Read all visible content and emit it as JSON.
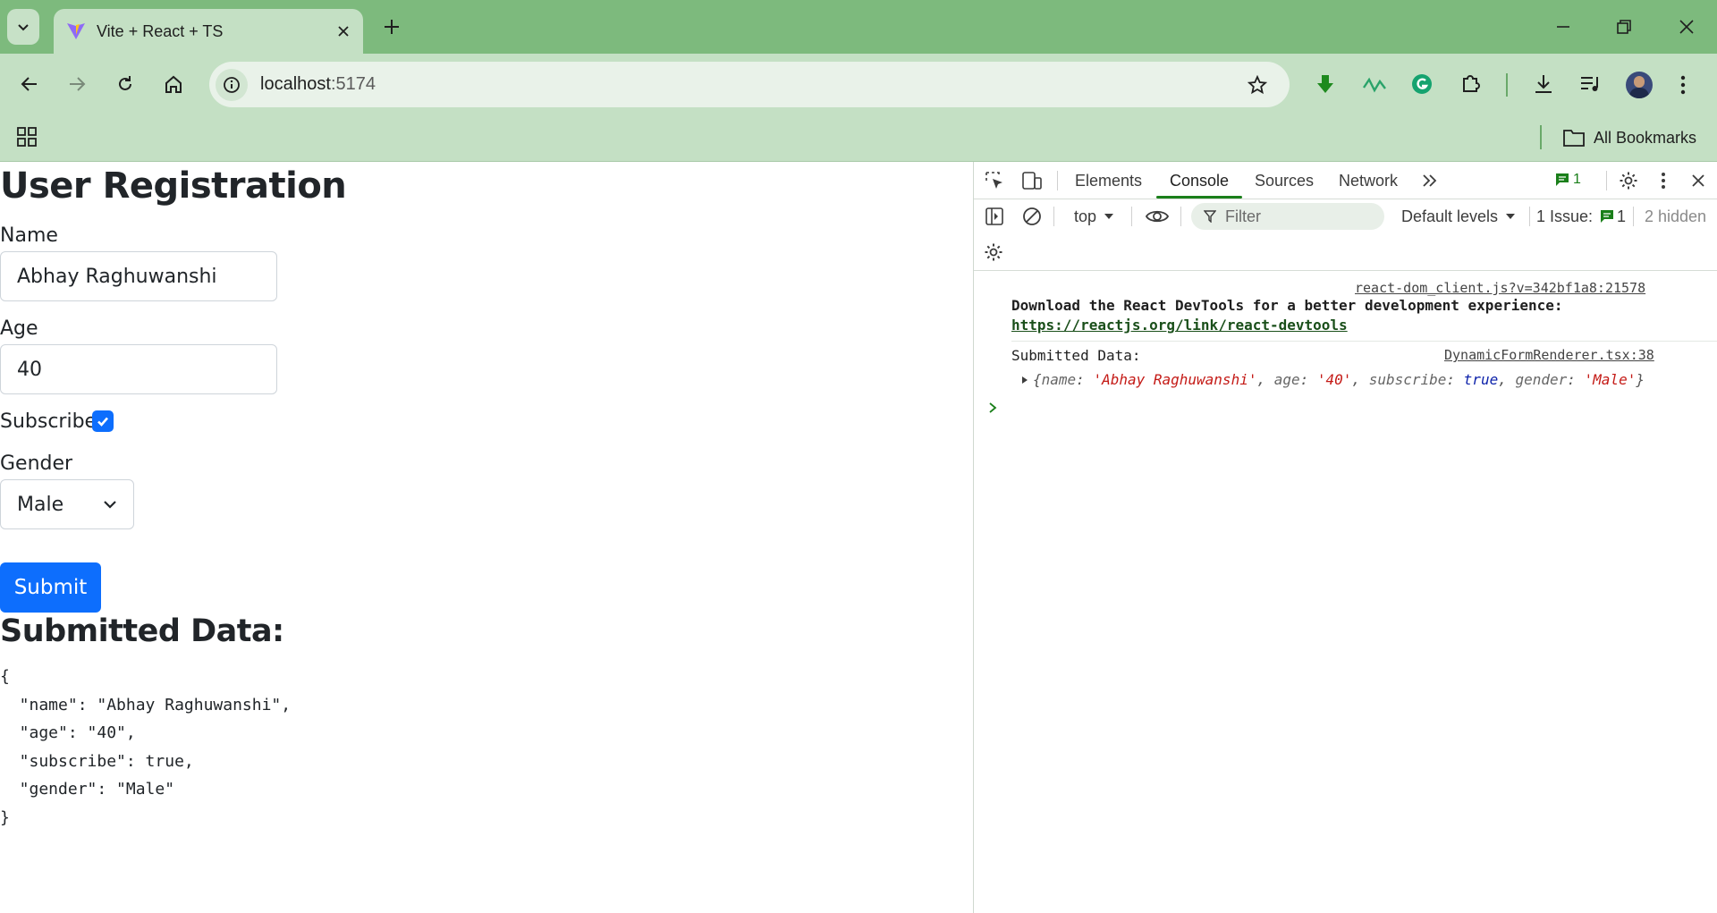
{
  "browser": {
    "tab_title": "Vite + React + TS",
    "url_host": "localhost",
    "url_port": ":5174",
    "bookmarks_label": "All Bookmarks"
  },
  "page": {
    "title": "User Registration",
    "fields": {
      "name_label": "Name",
      "name_value": "Abhay Raghuwanshi",
      "age_label": "Age",
      "age_value": "40",
      "subscribe_label": "Subscribe",
      "subscribe_checked": true,
      "gender_label": "Gender",
      "gender_value": "Male"
    },
    "submit_label": "Submit",
    "submitted_heading": "Submitted Data:",
    "json_lines": [
      "{",
      "  \"name\": \"Abhay Raghuwanshi\",",
      "  \"age\": \"40\",",
      "  \"subscribe\": true,",
      "  \"gender\": \"Male\"",
      "}"
    ]
  },
  "devtools": {
    "tabs": [
      "Elements",
      "Console",
      "Sources",
      "Network"
    ],
    "active_tab": "Console",
    "message_count": "1",
    "context": "top",
    "filter_placeholder": "Filter",
    "levels": "Default levels",
    "issues_label": "1 Issue:",
    "issues_count": "1",
    "hidden_label": "2 hidden",
    "messages": {
      "m1_source": "react-dom_client.js?v=342bf1a8:21578",
      "m1_text": "Download the React DevTools for a better development experience:",
      "m1_link": "https://reactjs.org/link/react-devtools",
      "m2_text": "Submitted Data:",
      "m2_source": "DynamicFormRenderer.tsx:38",
      "m2_obj_open": "{",
      "m2_k1": "name",
      "m2_v1": "'Abhay Raghuwanshi'",
      "m2_k2": "age",
      "m2_v2": "'40'",
      "m2_k3": "subscribe",
      "m2_v3": "true",
      "m2_k4": "gender",
      "m2_v4": "'Male'",
      "m2_obj_close": "}"
    }
  },
  "colors": {
    "tabstrip": "#7dba7d",
    "toolbar": "#c4e0c4",
    "primary": "#0d6efd",
    "console_string": "#c41a16",
    "console_keyword": "#0d22aa"
  }
}
